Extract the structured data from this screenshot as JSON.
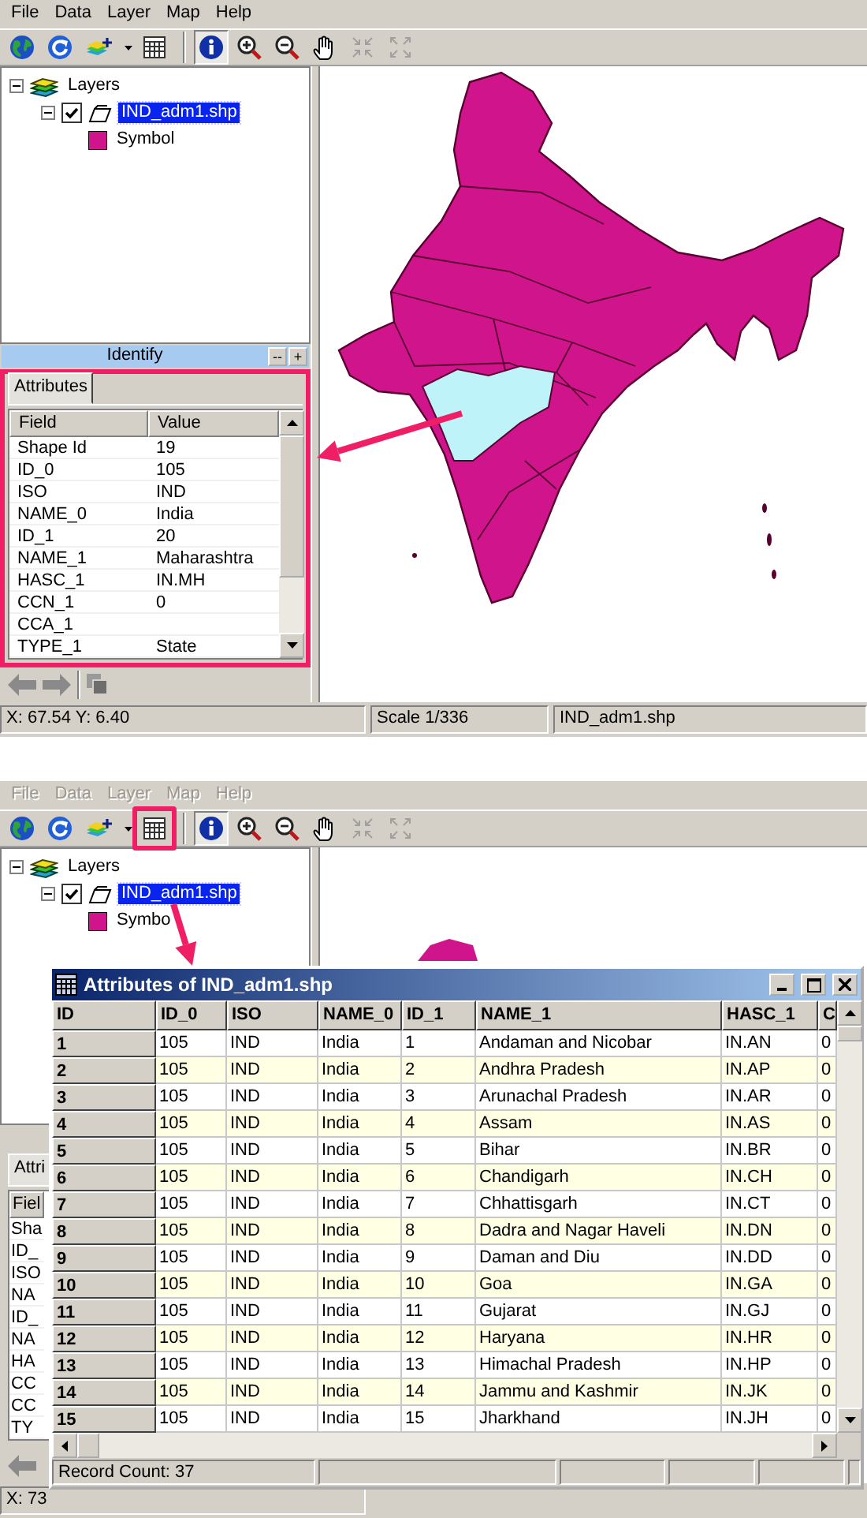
{
  "identify_view": {
    "menu": [
      {
        "label": "File",
        "disabled": false
      },
      {
        "label": "Data",
        "disabled": false
      },
      {
        "label": "Layer",
        "disabled": false
      },
      {
        "label": "Map",
        "disabled": false
      },
      {
        "label": "Help",
        "disabled": false
      }
    ],
    "tools": [
      {
        "kind": "globe",
        "selected": false,
        "disabled": false,
        "highlighted": false
      },
      {
        "kind": "refresh",
        "selected": false,
        "disabled": false,
        "highlighted": false
      },
      {
        "kind": "add-layer",
        "selected": false,
        "disabled": false,
        "highlighted": false
      },
      {
        "kind": "dropdown",
        "selected": false,
        "disabled": false,
        "highlighted": false
      },
      {
        "kind": "table",
        "selected": false,
        "disabled": false,
        "highlighted": false
      },
      {
        "kind": "identify",
        "selected": true,
        "disabled": false,
        "highlighted": false
      },
      {
        "kind": "zoom-in",
        "selected": false,
        "disabled": false,
        "highlighted": false
      },
      {
        "kind": "zoom-out",
        "selected": false,
        "disabled": false,
        "highlighted": false
      },
      {
        "kind": "pan",
        "selected": false,
        "disabled": false,
        "highlighted": false
      },
      {
        "kind": "zoom-full",
        "selected": false,
        "disabled": true,
        "highlighted": false
      },
      {
        "kind": "zoom-extent",
        "selected": false,
        "disabled": true,
        "highlighted": false
      }
    ],
    "layers": {
      "label": "Layers",
      "selected": false,
      "expanded": true,
      "children": [
        {
          "label": "IND_adm1.shp",
          "checked": true,
          "selected": true,
          "expanded": true,
          "children": [
            {
              "label": "Symbol",
              "selected": false,
              "color": "#d0158c"
            }
          ]
        }
      ]
    },
    "identify": {
      "title": "Identify",
      "buttons": [
        "--",
        "+"
      ],
      "highlighted": true,
      "tabs": [
        {
          "label": "Attributes",
          "selected": true
        }
      ],
      "columns": [
        "Field",
        "Value"
      ],
      "rows": [
        {
          "field": "Shape Id",
          "value": "19"
        },
        {
          "field": "ID_0",
          "value": "105"
        },
        {
          "field": "ISO",
          "value": "IND"
        },
        {
          "field": "NAME_0",
          "value": "India"
        },
        {
          "field": "ID_1",
          "value": "20"
        },
        {
          "field": "NAME_1",
          "value": "Maharashtra"
        },
        {
          "field": "HASC_1",
          "value": "IN.MH"
        },
        {
          "field": "CCN_1",
          "value": "0"
        },
        {
          "field": "CCA_1"
        },
        {
          "field": "TYPE_1",
          "value": "State"
        }
      ]
    },
    "status_bar": [
      "X: 67.54 Y: 6.40",
      "Scale 1/336",
      "IND_adm1.shp"
    ]
  },
  "table_view": {
    "menu": [
      {
        "label": "File",
        "disabled": true
      },
      {
        "label": "Data",
        "disabled": true
      },
      {
        "label": "Layer",
        "disabled": true
      },
      {
        "label": "Map",
        "disabled": true
      },
      {
        "label": "Help",
        "disabled": true
      }
    ],
    "tools": [
      {
        "kind": "globe",
        "selected": false,
        "disabled": false,
        "highlighted": false
      },
      {
        "kind": "refresh",
        "selected": false,
        "disabled": false,
        "highlighted": false
      },
      {
        "kind": "add-layer",
        "selected": false,
        "disabled": false,
        "highlighted": false
      },
      {
        "kind": "dropdown",
        "selected": false,
        "disabled": false,
        "highlighted": false
      },
      {
        "kind": "table",
        "selected": false,
        "disabled": false,
        "highlighted": true
      },
      {
        "kind": "identify",
        "selected": true,
        "disabled": false,
        "highlighted": false
      },
      {
        "kind": "zoom-in",
        "selected": false,
        "disabled": false,
        "highlighted": false
      },
      {
        "kind": "zoom-out",
        "selected": false,
        "disabled": false,
        "highlighted": false
      },
      {
        "kind": "pan",
        "selected": false,
        "disabled": false,
        "highlighted": false
      },
      {
        "kind": "zoom-full",
        "selected": false,
        "disabled": true,
        "highlighted": false
      },
      {
        "kind": "zoom-extent",
        "selected": false,
        "disabled": true,
        "highlighted": false
      }
    ],
    "layers": {
      "label": "Layers",
      "selected": false,
      "expanded": true,
      "children": [
        {
          "label": "IND_adm1.shp",
          "checked": true,
          "selected": true,
          "expanded": true,
          "children": [
            {
              "label": "Symbo",
              "selected": false,
              "color": "#d0158c"
            }
          ]
        }
      ]
    },
    "identify": {
      "highlighted": false,
      "tabs": [
        {
          "label": "Attri",
          "selected": true
        }
      ],
      "columns": [
        "Fiel"
      ],
      "rows": [
        {
          "field": "Sha"
        },
        {
          "field": "ID_"
        },
        {
          "field": "ISO"
        },
        {
          "field": "NA"
        },
        {
          "field": "ID_"
        },
        {
          "field": "NA"
        },
        {
          "field": "HA"
        },
        {
          "field": "CC"
        },
        {
          "field": "CC"
        },
        {
          "field": "TY"
        }
      ]
    },
    "attribute_window": {
      "title": "Attributes of IND_adm1.shp",
      "columns": [
        "ID",
        "ID_0",
        "ISO",
        "NAME_0",
        "ID_1",
        "NAME_1",
        "HASC_1",
        "C"
      ],
      "rows": [
        [
          "1",
          "105",
          "IND",
          "India",
          "1",
          "Andaman and Nicobar",
          "IN.AN",
          "0"
        ],
        [
          "2",
          "105",
          "IND",
          "India",
          "2",
          "Andhra Pradesh",
          "IN.AP",
          "0"
        ],
        [
          "3",
          "105",
          "IND",
          "India",
          "3",
          "Arunachal Pradesh",
          "IN.AR",
          "0"
        ],
        [
          "4",
          "105",
          "IND",
          "India",
          "4",
          "Assam",
          "IN.AS",
          "0"
        ],
        [
          "5",
          "105",
          "IND",
          "India",
          "5",
          "Bihar",
          "IN.BR",
          "0"
        ],
        [
          "6",
          "105",
          "IND",
          "India",
          "6",
          "Chandigarh",
          "IN.CH",
          "0"
        ],
        [
          "7",
          "105",
          "IND",
          "India",
          "7",
          "Chhattisgarh",
          "IN.CT",
          "0"
        ],
        [
          "8",
          "105",
          "IND",
          "India",
          "8",
          "Dadra and Nagar Haveli",
          "IN.DN",
          "0"
        ],
        [
          "9",
          "105",
          "IND",
          "India",
          "9",
          "Daman and Diu",
          "IN.DD",
          "0"
        ],
        [
          "10",
          "105",
          "IND",
          "India",
          "10",
          "Goa",
          "IN.GA",
          "0"
        ],
        [
          "11",
          "105",
          "IND",
          "India",
          "11",
          "Gujarat",
          "IN.GJ",
          "0"
        ],
        [
          "12",
          "105",
          "IND",
          "India",
          "12",
          "Haryana",
          "IN.HR",
          "0"
        ],
        [
          "13",
          "105",
          "IND",
          "India",
          "13",
          "Himachal Pradesh",
          "IN.HP",
          "0"
        ],
        [
          "14",
          "105",
          "IND",
          "India",
          "14",
          "Jammu and Kashmir",
          "IN.JK",
          "0"
        ],
        [
          "15",
          "105",
          "IND",
          "India",
          "15",
          "Jharkhand",
          "IN.JH",
          "0"
        ]
      ],
      "status": "Record Count: 37"
    },
    "status_bar": [
      "X: 73"
    ]
  }
}
